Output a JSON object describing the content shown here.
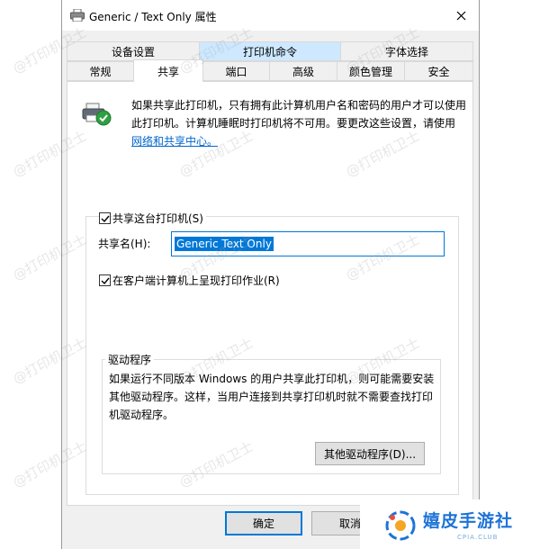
{
  "window": {
    "title": "Generic / Text Only 属性",
    "close_label": "✕"
  },
  "tabs_row1": [
    "设备设置",
    "打印机命令",
    "字体选择"
  ],
  "tabs_row2": [
    "常规",
    "共享",
    "端口",
    "高级",
    "颜色管理",
    "安全"
  ],
  "active_tab": "共享",
  "sharing": {
    "intro_text": "如果共享此打印机，只有拥有此计算机用户名和密码的用户才可以使用此打印机。计算机睡眠时打印机将不可用。要更改这些设置，请使用",
    "intro_link": "网络和共享中心。",
    "share_checkbox_label": "共享这台打印机(S)",
    "share_checked": true,
    "share_name_label": "共享名(H):",
    "share_name_value": "Generic  Text Only",
    "render_checkbox_label": "在客户端计算机上呈现打印作业(R)",
    "render_checked": true,
    "drivers_group_title": "驱动程序",
    "drivers_text": "如果运行不同版本 Windows 的用户共享此打印机，则可能需要安装其他驱动程序。这样，当用户连接到共享打印机时就不需要查找打印机驱动程序。",
    "other_drivers_button": "其他驱动程序(D)..."
  },
  "footer": {
    "ok_button": "确定",
    "cancel_button": "取消"
  },
  "watermark": "@打印机卫士",
  "brand": {
    "name": "嬉皮手游社",
    "sub": "CPIA.CLUB"
  },
  "colors": {
    "accent": "#0078d7",
    "link": "#0066cc",
    "brand": "#1e73d6",
    "selection": "#0078d7"
  }
}
